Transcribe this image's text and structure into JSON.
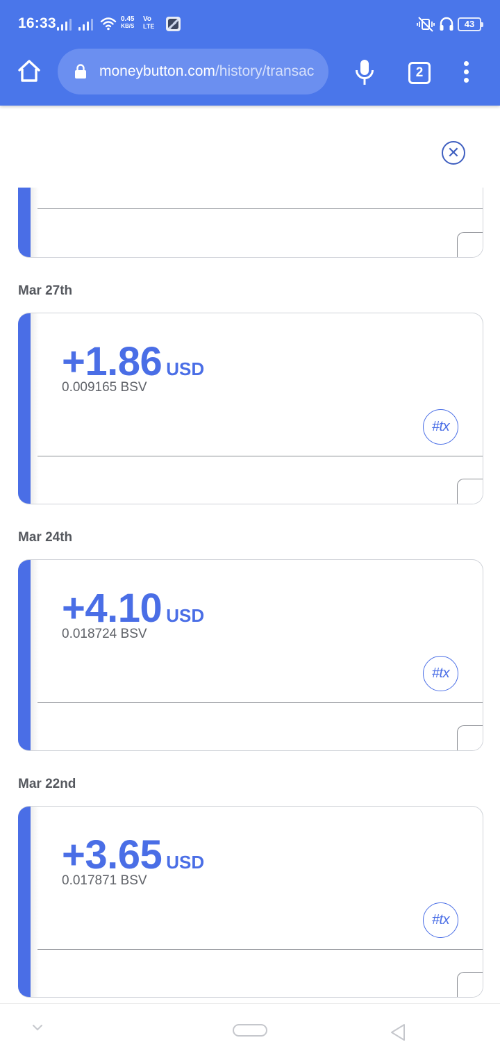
{
  "status_bar": {
    "time": "16:33",
    "net_speed_value": "0.45",
    "net_speed_unit": "KB/S",
    "volte_top": "Vo",
    "volte_bottom": "LTE",
    "battery": "43"
  },
  "browser": {
    "url_domain": "moneybutton.com",
    "url_path": "/history/transac",
    "tab_count": "2",
    "accent_color": "#4a76ea"
  },
  "page": {
    "accent_color": "#4a6ee6",
    "transactions": [
      {
        "date": "Mar 27th",
        "amount": "+1.86",
        "currency": "USD",
        "bsv": "0.009165 BSV",
        "tx_label": "#tx"
      },
      {
        "date": "Mar 24th",
        "amount": "+4.10",
        "currency": "USD",
        "bsv": "0.018724 BSV",
        "tx_label": "#tx"
      },
      {
        "date": "Mar 22nd",
        "amount": "+3.65",
        "currency": "USD",
        "bsv": "0.017871 BSV",
        "tx_label": "#tx"
      }
    ]
  },
  "icons": {
    "close": "close-icon",
    "home": "home-icon",
    "lock": "lock-icon",
    "mic": "mic-icon",
    "menu": "more-vert-icon"
  }
}
